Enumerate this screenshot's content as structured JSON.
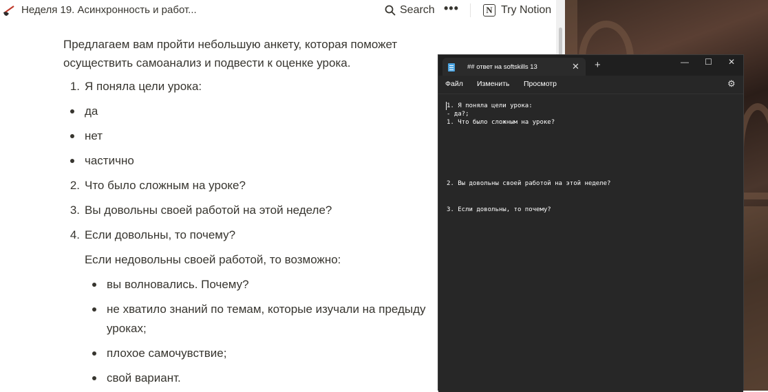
{
  "notion": {
    "page_title": "Неделя 19. Асинхронность и работ...",
    "search_label": "Search",
    "more_label": "•••",
    "try_notion_label": "Try Notion",
    "intro": "Предлагаем вам пройти небольшую анкету, которая поможет осуществить самоанализ и подвести к оценке урока.",
    "items": [
      {
        "num": "1.",
        "text": "Я поняла цели урока:"
      },
      {
        "bullet": "да"
      },
      {
        "bullet": "нет"
      },
      {
        "bullet": "частично"
      },
      {
        "num": "2.",
        "text": "Что было сложным на уроке?"
      },
      {
        "num": "3.",
        "text": "Вы довольны своей работой на этой неделе?"
      },
      {
        "num": "4.",
        "text": "Если довольны, то почему?"
      }
    ],
    "sub_intro": "Если недовольны своей работой, то возможно:",
    "sub_bullets": [
      "вы волновались. Почему?",
      "не хватило знаний по темам, которые изучали на предыду",
      "уроках;",
      "плохое самочувствие;",
      "свой вариант."
    ]
  },
  "notepad": {
    "tab_title": "## ответ на softskills 13",
    "menu": [
      "Файл",
      "Изменить",
      "Просмотр"
    ],
    "lines": [
      "1. Я поняла цели урока:",
      "- да?;",
      "1. Что было сложным на уроке?",
      "2. Вы довольны своей работой на этой неделе?",
      "3. Если довольны, то почему?"
    ]
  }
}
